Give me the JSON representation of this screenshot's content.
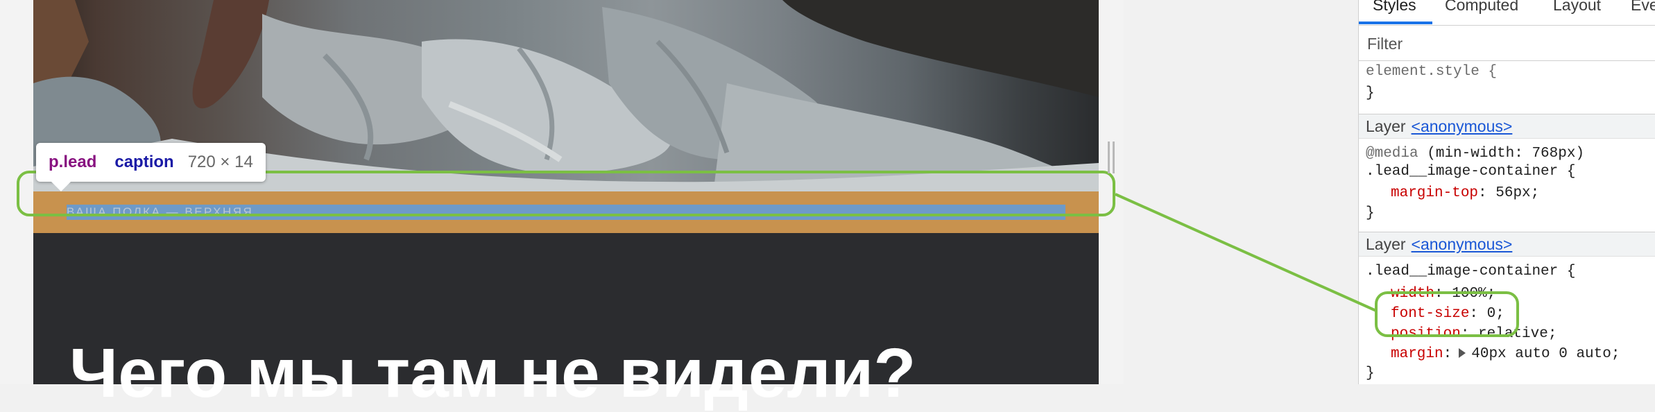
{
  "page": {
    "caption_text": "ВАША ПОЛКА — ВЕРХНЯЯ",
    "headline": "Чего мы там не видели?"
  },
  "inspector_tooltip": {
    "tag": "p.lead",
    "class_name": "caption",
    "size": "720 × 14"
  },
  "devtools": {
    "tabs": [
      "Styles",
      "Computed",
      "Layout",
      "Eve"
    ],
    "active_tab": "Styles",
    "filter_placeholder": "Filter",
    "element_style": {
      "selector": "element.style {",
      "close": "}"
    },
    "layer_label": "Layer",
    "layer_link": "<anonymous>",
    "rule1": {
      "media": "@media",
      "media_query": "(min-width: 768px)",
      "selector": ".lead__image-container {",
      "props": [
        {
          "name": "margin-top",
          "value": "56px;"
        }
      ],
      "close": "}"
    },
    "rule2": {
      "selector": ".lead__image-container {",
      "props": [
        {
          "name": "width",
          "value": "100%;"
        },
        {
          "name": "font-size",
          "value": "0;"
        },
        {
          "name": "position",
          "value": "relative;"
        },
        {
          "name": "margin",
          "value": "40px auto 0 auto;"
        }
      ],
      "close": "}"
    }
  },
  "colors": {
    "highlight_green": "#7bbf44",
    "padding_orange": "#c8924e",
    "content_blue": "#6e9ac8",
    "dark_section": "#2b2c2f",
    "css_property_red": "#c80000",
    "link_blue": "#1a57d6",
    "tab_underline": "#1a73e8"
  }
}
